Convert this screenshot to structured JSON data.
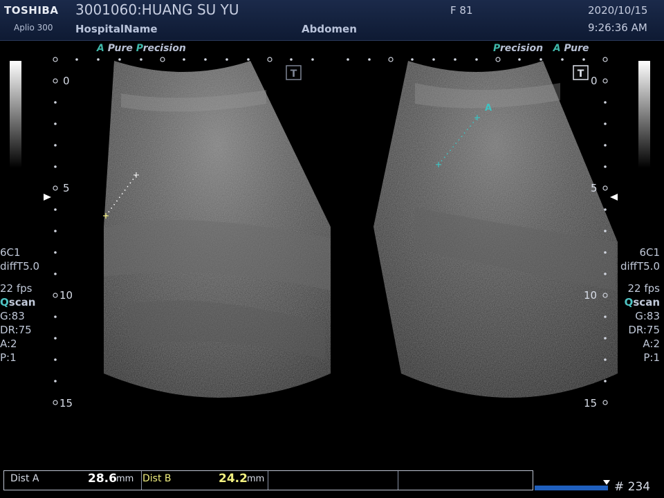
{
  "header": {
    "brand": "TOSHIBA",
    "model": "Aplio 300",
    "patient": "3001060:HUANG SU YU",
    "hospital": "HospitalName",
    "exam": "Abdomen",
    "frame_tag": "F  81",
    "date": "2020/10/15",
    "time": "9:26:36 AM"
  },
  "brand_tags": {
    "left_a": "A",
    "left_pure": "Pure",
    "left_p": "P",
    "left_recision": "recision",
    "right_p": "P",
    "right_recision": "recision",
    "right_a": "A",
    "right_pure": "Pure"
  },
  "depth_scale": {
    "d0": "0",
    "d5": "5",
    "d10": "10",
    "d15": "15"
  },
  "params_left": {
    "probe": "6C1",
    "mode": "diffT5.0",
    "fps": "22 fps",
    "qscan_q": "Q",
    "qscan_rest": "scan",
    "gain": "G:83",
    "dr": "DR:75",
    "a": "A:2",
    "p": "P:1"
  },
  "params_right": {
    "probe": "6C1",
    "mode": "diffT5.0",
    "fps": "22 fps",
    "qscan_q": "Q",
    "qscan_rest": "scan",
    "gain": "G:83",
    "dr": "DR:75",
    "a": "A:2",
    "p": "P:1"
  },
  "panel_marks": {
    "left_t": "T",
    "right_t": "T",
    "caliper_a": "A"
  },
  "measurements": {
    "dist_a_label": "Dist A",
    "dist_a_value": "28.6",
    "dist_a_unit": "mm",
    "dist_b_label": "Dist B",
    "dist_b_value": "24.2",
    "dist_b_unit": "mm"
  },
  "footer": {
    "frame_count": "# 234"
  },
  "colors": {
    "caliper_a": "#3fc3c3",
    "caliper_b": "#f2f080",
    "accent": "#1f5fbd"
  }
}
